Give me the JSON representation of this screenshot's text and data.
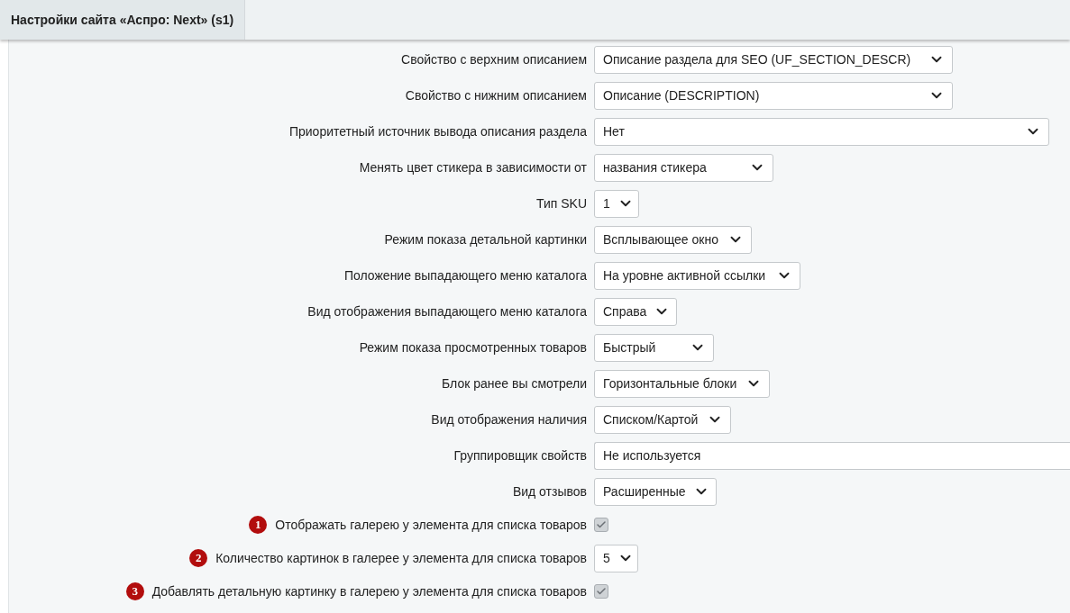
{
  "tab": {
    "title": "Настройки сайта «Аспро: Next» (s1)",
    "selected": true
  },
  "rows": [
    {
      "kind": "select",
      "label": "Свойство с верхним описанием",
      "value": "Описание раздела для SEO (UF_SECTION_DESCR)"
    },
    {
      "kind": "select",
      "label": "Свойство с нижним описанием",
      "value": "Описание (DESCRIPTION)"
    },
    {
      "kind": "select",
      "label": "Приоритетный источник вывода описания раздела",
      "value": "Нет"
    },
    {
      "kind": "select",
      "label": "Менять цвет стикера в зависимости от",
      "value": "названия стикера"
    },
    {
      "kind": "select",
      "label": "Тип SKU",
      "value": "1"
    },
    {
      "kind": "select",
      "label": "Режим показа детальной картинки",
      "value": "Всплывающее окно"
    },
    {
      "kind": "select",
      "label": "Положение выпадающего меню каталога",
      "value": "На уровне активной ссылки"
    },
    {
      "kind": "select",
      "label": "Вид отображения выпадающего меню каталога",
      "value": "Справа"
    },
    {
      "kind": "select",
      "label": "Режим показа просмотренных товаров",
      "value": "Быстрый"
    },
    {
      "kind": "select",
      "label": "Блок ранее вы смотрели",
      "value": "Горизонтальные блоки"
    },
    {
      "kind": "select",
      "label": "Вид отображения наличия",
      "value": "Списком/Картой"
    },
    {
      "kind": "input",
      "label": "Группировщик свойств",
      "value": "Не используется"
    },
    {
      "kind": "select",
      "label": "Вид отзывов",
      "value": "Расширенные"
    },
    {
      "kind": "checkbox",
      "badge": "1",
      "label": "Отображать галерею у элемента для списка товаров",
      "checked": true
    },
    {
      "kind": "select",
      "badge": "2",
      "label": "Количество картинок в галерее у элемента для списка товаров",
      "value": "5"
    },
    {
      "kind": "checkbox",
      "badge": "3",
      "label": "Добавлять детальную картинку в галерею у элемента для списка товаров",
      "checked": true
    }
  ]
}
